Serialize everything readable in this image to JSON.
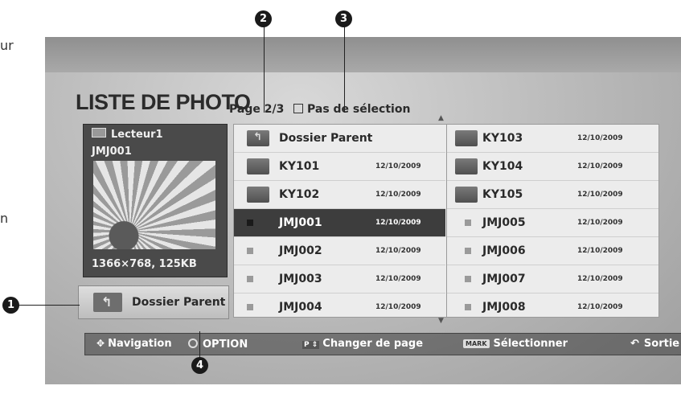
{
  "margin_fragments": [
    "ur",
    "n"
  ],
  "callouts": [
    "1",
    "2",
    "3",
    "4"
  ],
  "screen": {
    "title": "LISTE DE PHOTO",
    "page_indicator": "Page 2/3",
    "selection_label": "Pas de sélection",
    "preview": {
      "source_label": "Lecteur1",
      "file_name": "JMJ001",
      "info": "1366×768, 125KB"
    },
    "parent_button": "Dossier Parent",
    "left_column": [
      {
        "name": "Dossier Parent",
        "date": "",
        "type": "parent-folder"
      },
      {
        "name": "KY101",
        "date": "12/10/2009",
        "type": "folder"
      },
      {
        "name": "KY102",
        "date": "12/10/2009",
        "type": "folder"
      },
      {
        "name": "JMJ001",
        "date": "12/10/2009",
        "type": "file",
        "selected": true
      },
      {
        "name": "JMJ002",
        "date": "12/10/2009",
        "type": "file"
      },
      {
        "name": "JMJ003",
        "date": "12/10/2009",
        "type": "file"
      },
      {
        "name": "JMJ004",
        "date": "12/10/2009",
        "type": "file"
      }
    ],
    "right_column": [
      {
        "name": "KY103",
        "date": "12/10/2009",
        "type": "folder"
      },
      {
        "name": "KY104",
        "date": "12/10/2009",
        "type": "folder"
      },
      {
        "name": "KY105",
        "date": "12/10/2009",
        "type": "folder"
      },
      {
        "name": "JMJ005",
        "date": "12/10/2009",
        "type": "file"
      },
      {
        "name": "JMJ006",
        "date": "12/10/2009",
        "type": "file"
      },
      {
        "name": "JMJ007",
        "date": "12/10/2009",
        "type": "file"
      },
      {
        "name": "JMJ008",
        "date": "12/10/2009",
        "type": "file"
      }
    ],
    "bottom_bar": {
      "navigation": "Navigation",
      "option": "OPTION",
      "page_key": "P",
      "change_page": "Changer de page",
      "mark_key": "MARK",
      "select": "Sélectionner",
      "exit": "Sortie"
    }
  }
}
